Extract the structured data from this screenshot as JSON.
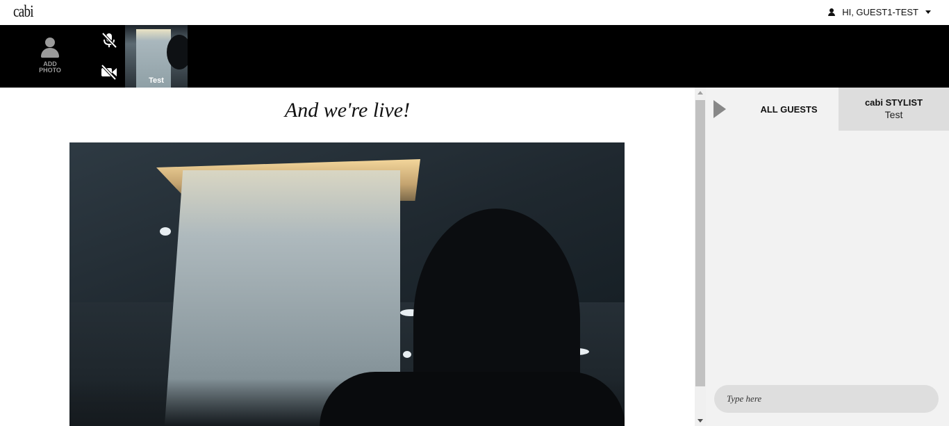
{
  "header": {
    "logo": "cabi",
    "user_greeting": "HI, GUEST1-TEST"
  },
  "strip": {
    "add_photo_line1": "ADD",
    "add_photo_line2": "PHOTO",
    "mic_icon": "mic-muted-icon",
    "camera_icon": "camera-off-icon",
    "participant_name": "Test"
  },
  "main": {
    "headline": "And we're live!"
  },
  "chat": {
    "tab_all_guests": "ALL GUESTS",
    "tab_stylist_title": "cabi STYLIST",
    "tab_stylist_name": "Test",
    "input_placeholder": "Type here"
  },
  "colors": {
    "strip_bg": "#000000",
    "chat_bg": "#f2f2f2",
    "stylist_tab_bg": "#dddddd"
  }
}
